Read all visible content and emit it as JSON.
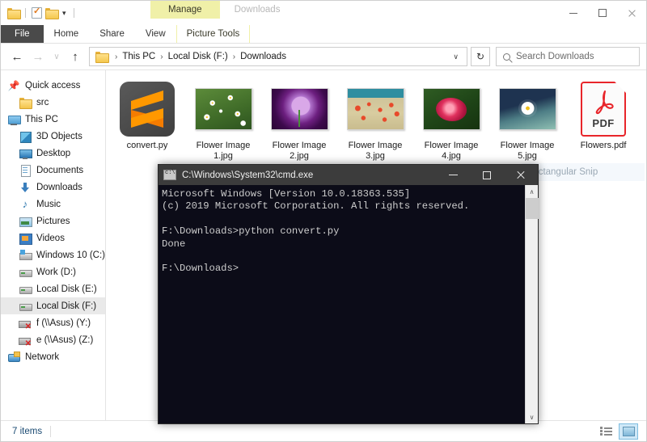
{
  "window": {
    "title_doc": "Downloads",
    "contextual_group": "Manage",
    "contextual_tab": "Picture Tools",
    "quick_access": [
      {
        "name": "folder-icon"
      },
      {
        "name": "properties-icon"
      },
      {
        "name": "new-folder-icon"
      },
      {
        "name": "customize-chevron-icon"
      }
    ],
    "controls": {
      "minimize": "minimize-button",
      "maximize": "maximize-button",
      "close": "close-button"
    }
  },
  "ribbon": {
    "tabs": [
      "File",
      "Home",
      "Share",
      "View"
    ]
  },
  "address": {
    "back": "←",
    "forward": "→",
    "recent": "∨",
    "up": "↑",
    "crumbs": [
      "This PC",
      "Local Disk (F:)",
      "Downloads"
    ],
    "separator": "›",
    "dropdown": "∨",
    "refresh": "↻"
  },
  "search": {
    "placeholder": "Search Downloads"
  },
  "sidebar": {
    "items": [
      {
        "label": "Quick access",
        "icon": "pin-icon",
        "level": 0,
        "selected": false,
        "icon_class": "ic-pin",
        "glyph": "📌"
      },
      {
        "label": "src",
        "icon": "folder-icon",
        "level": 1,
        "selected": false,
        "icon_class": "ic-folder",
        "glyph": ""
      },
      {
        "label": "This PC",
        "icon": "this-pc-icon",
        "level": 0,
        "selected": false,
        "icon_class": "ic-pc",
        "glyph": ""
      },
      {
        "label": "3D Objects",
        "icon": "3d-objects-icon",
        "level": 1,
        "selected": false,
        "icon_class": "ic-3d",
        "glyph": ""
      },
      {
        "label": "Desktop",
        "icon": "desktop-icon",
        "level": 1,
        "selected": false,
        "icon_class": "ic-desk",
        "glyph": ""
      },
      {
        "label": "Documents",
        "icon": "documents-icon",
        "level": 1,
        "selected": false,
        "icon_class": "ic-doc",
        "glyph": ""
      },
      {
        "label": "Downloads",
        "icon": "downloads-icon",
        "level": 1,
        "selected": false,
        "icon_class": "ic-down",
        "glyph": ""
      },
      {
        "label": "Music",
        "icon": "music-icon",
        "level": 1,
        "selected": false,
        "icon_class": "ic-music",
        "glyph": "♪"
      },
      {
        "label": "Pictures",
        "icon": "pictures-icon",
        "level": 1,
        "selected": false,
        "icon_class": "ic-pict",
        "glyph": ""
      },
      {
        "label": "Videos",
        "icon": "videos-icon",
        "level": 1,
        "selected": false,
        "icon_class": "ic-vid",
        "glyph": ""
      },
      {
        "label": "Windows 10 (C:)",
        "icon": "windows-drive-icon",
        "level": 1,
        "selected": false,
        "icon_class": "ic-drive-win",
        "glyph": ""
      },
      {
        "label": "Work (D:)",
        "icon": "drive-icon",
        "level": 1,
        "selected": false,
        "icon_class": "ic-drive",
        "glyph": ""
      },
      {
        "label": "Local Disk (E:)",
        "icon": "drive-icon",
        "level": 1,
        "selected": false,
        "icon_class": "ic-drive",
        "glyph": ""
      },
      {
        "label": "Local Disk (F:)",
        "icon": "drive-icon",
        "level": 1,
        "selected": true,
        "icon_class": "ic-drive",
        "glyph": ""
      },
      {
        "label": "f (\\\\Asus) (Y:)",
        "icon": "network-drive-disconnected-icon",
        "level": 1,
        "selected": false,
        "icon_class": "ic-netdrive",
        "glyph": ""
      },
      {
        "label": "e (\\\\Asus) (Z:)",
        "icon": "network-drive-disconnected-icon",
        "level": 1,
        "selected": false,
        "icon_class": "ic-netdrive",
        "glyph": ""
      },
      {
        "label": "Network",
        "icon": "network-icon",
        "level": 0,
        "selected": false,
        "icon_class": "ic-net",
        "glyph": ""
      }
    ]
  },
  "files": [
    {
      "name": "convert.py",
      "kind": "sublime-python-file"
    },
    {
      "name": "Flower Image 1.jpg",
      "kind": "image-thumbnail",
      "thumb": "ph1"
    },
    {
      "name": "Flower Image 2.jpg",
      "kind": "image-thumbnail",
      "thumb": "ph2"
    },
    {
      "name": "Flower Image 3.jpg",
      "kind": "image-thumbnail",
      "thumb": "ph3"
    },
    {
      "name": "Flower Image 4.jpg",
      "kind": "image-thumbnail",
      "thumb": "ph4"
    },
    {
      "name": "Flower Image 5.jpg",
      "kind": "image-thumbnail",
      "thumb": "ph5"
    },
    {
      "name": "Flowers.pdf",
      "kind": "pdf-file",
      "badge": "PDF"
    }
  ],
  "overlay": {
    "snip_label": "Rectangular Snip"
  },
  "statusbar": {
    "item_count": "7 items",
    "views": [
      {
        "name": "details-view-button",
        "active": false
      },
      {
        "name": "large-icons-view-button",
        "active": true
      }
    ]
  },
  "cmd": {
    "title": "C:\\Windows\\System32\\cmd.exe",
    "output": "Microsoft Windows [Version 10.0.18363.535]\n(c) 2019 Microsoft Corporation. All rights reserved.\n\nF:\\Downloads>python convert.py\nDone\n\nF:\\Downloads>",
    "scroll": {
      "up": "∧",
      "down": "∨"
    }
  },
  "colors": {
    "accent_yellow": "#f0f0a8",
    "file_tab": "#4a4a4a",
    "cmd_bg": "#0c0c18",
    "cmd_titlebar": "#3c3c3c",
    "pdf_red": "#e8252a",
    "sublime_orange": "#ff9800",
    "selection_gray": "#e9e9e9"
  }
}
